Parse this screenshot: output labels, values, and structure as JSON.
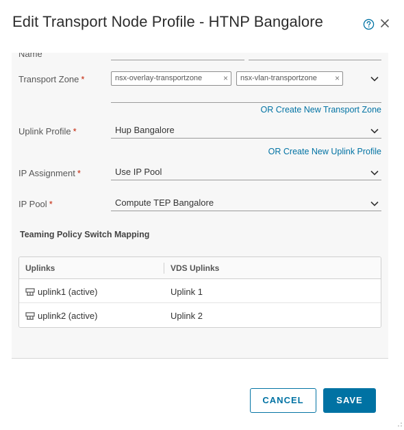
{
  "dialog": {
    "title": "Edit Transport Node Profile - HTNP Bangalore",
    "help_icon": "help-circle-icon",
    "close_icon": "close-icon"
  },
  "form": {
    "name_label": "Name",
    "transport_zone": {
      "label": "Transport Zone",
      "required_mark": "*",
      "chips": [
        {
          "label": "nsx-overlay-transportzone",
          "remove": "×"
        },
        {
          "label": "nsx-vlan-transportzone",
          "remove": "×"
        }
      ],
      "create_link": "OR Create New Transport Zone"
    },
    "uplink_profile": {
      "label": "Uplink Profile",
      "required_mark": "*",
      "value": "Hup Bangalore",
      "create_link": "OR Create New Uplink Profile"
    },
    "ip_assignment": {
      "label": "IP Assignment",
      "required_mark": "*",
      "value": "Use IP Pool"
    },
    "ip_pool": {
      "label": "IP Pool",
      "required_mark": "*",
      "value": "Compute TEP Bangalore"
    }
  },
  "teaming": {
    "title": "Teaming Policy Switch Mapping",
    "columns": [
      "Uplinks",
      "VDS Uplinks"
    ],
    "rows": [
      {
        "uplink": "uplink1 (active)",
        "vds_uplink": "Uplink 1",
        "icon": "uplink-icon"
      },
      {
        "uplink": "uplink2 (active)",
        "vds_uplink": "Uplink 2",
        "icon": "uplink-icon"
      }
    ]
  },
  "footer": {
    "cancel_label": "CANCEL",
    "save_label": "SAVE"
  },
  "colors": {
    "accent": "#0072a3",
    "required": "#c21d00",
    "form_background": "#f7f7f7"
  }
}
